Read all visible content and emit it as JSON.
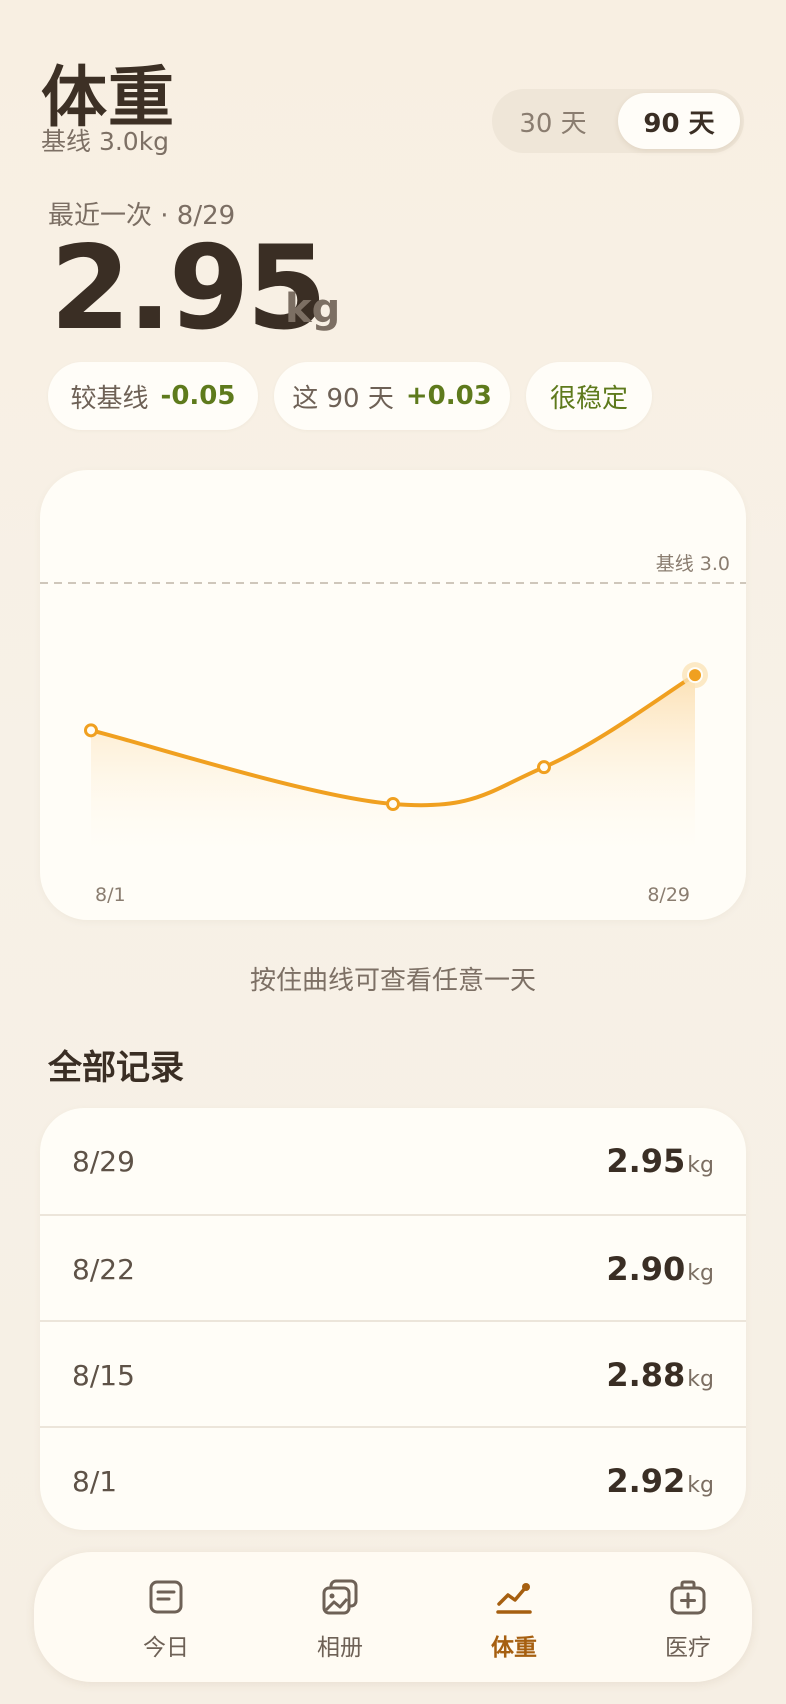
{
  "header": {
    "title": "体重",
    "baseline_label": "基线 3.0kg",
    "range_options": [
      "30 天",
      "90 天"
    ],
    "range_selected": "90 天"
  },
  "latest": {
    "label": "最近一次 · 8/29",
    "value": "2.95",
    "unit": "kg"
  },
  "stats": [
    {
      "label": "较基线",
      "value": "-0.05"
    },
    {
      "label": "这 90 天",
      "value": "+0.03"
    },
    {
      "label": "很稳定"
    }
  ],
  "chart_data": {
    "type": "line",
    "x": [
      "8/1",
      "8/15",
      "8/22",
      "8/29"
    ],
    "values": [
      2.92,
      2.88,
      2.9,
      2.95
    ],
    "baseline": 3.0,
    "baseline_label": "基线 3.0",
    "x_tick_labels": [
      "8/1",
      "8/29"
    ],
    "line_color": "#f0a020",
    "grid": false
  },
  "hint": "按住曲线可查看任意一天",
  "records": {
    "title": "全部记录",
    "unit": "kg",
    "rows": [
      {
        "date": "8/29",
        "value": "2.95"
      },
      {
        "date": "8/22",
        "value": "2.90"
      },
      {
        "date": "8/15",
        "value": "2.88"
      },
      {
        "date": "8/1",
        "value": "2.92"
      }
    ]
  },
  "tabbar": {
    "items": [
      {
        "label": "今日",
        "icon": "note-icon"
      },
      {
        "label": "相册",
        "icon": "photos-icon"
      },
      {
        "label": "体重",
        "icon": "trend-icon"
      },
      {
        "label": "医疗",
        "icon": "medkit-icon"
      }
    ],
    "active": "体重",
    "accent_color": "#a65f10"
  }
}
